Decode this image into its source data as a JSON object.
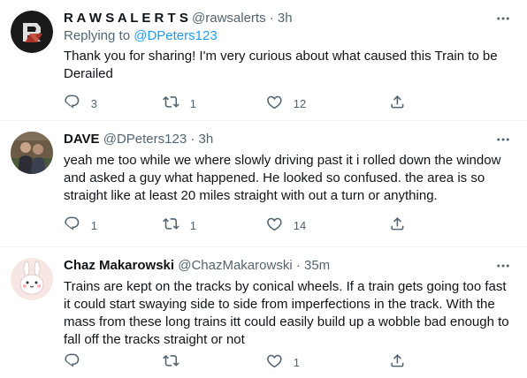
{
  "tweets": [
    {
      "display_name": "R A W S A L E R T S",
      "handle": "@rawsalerts",
      "time": "· 3h",
      "replying_prefix": "Replying to ",
      "replying_handle": "@DPeters123",
      "text": "Thank you for sharing! I'm very curious about what caused this Train to be Derailed",
      "replies": "3",
      "retweets": "1",
      "likes": "12"
    },
    {
      "display_name": "DAVE",
      "handle": "@DPeters123",
      "time": "· 3h",
      "text": "yeah me too while we where slowly driving past it i rolled down the window and asked a guy what happened. He looked so confused. the area is so straight like at least 20 miles straight with out a turn or anything.",
      "replies": "1",
      "retweets": "1",
      "likes": "14"
    },
    {
      "display_name": "Chaz Makarowski",
      "handle": "@ChazMakarowski",
      "time": "· 35m",
      "text": "Trains are kept on the tracks by conical wheels. If a train gets going too fast it could start swaying side to side from imperfections in the track. With the mass from these long trains itt could easily build up a wobble bad enough to fall off the tracks straight or not",
      "replies": "",
      "retweets": "",
      "likes": "1"
    }
  ],
  "icons": [
    "more-icon",
    "reply-icon",
    "retweet-icon",
    "like-icon",
    "share-icon"
  ],
  "colors": {
    "accent": "#1d9bf0",
    "secondary_text": "#536471",
    "primary_text": "#0f1419",
    "divider": "#eff3f4"
  }
}
